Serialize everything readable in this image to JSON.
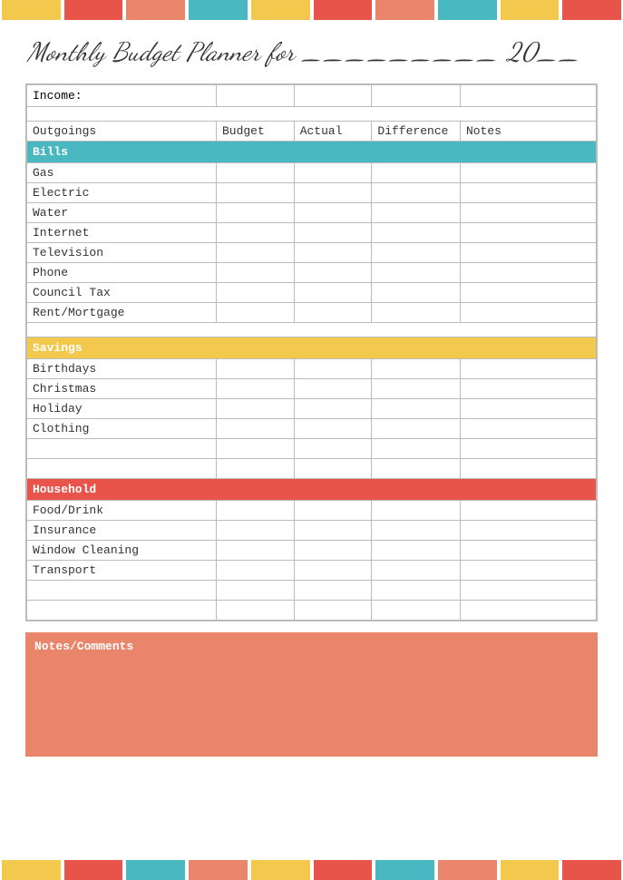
{
  "colorBarsTop": [
    {
      "color": "cb-yellow"
    },
    {
      "color": "cb-red"
    },
    {
      "color": "cb-salmon"
    },
    {
      "color": "cb-teal"
    },
    {
      "color": "cb-yellow"
    },
    {
      "color": "cb-red"
    },
    {
      "color": "cb-salmon"
    },
    {
      "color": "cb-teal"
    },
    {
      "color": "cb-yellow"
    },
    {
      "color": "cb-red"
    }
  ],
  "colorBarsBottom": [
    {
      "color": "cb-yellow"
    },
    {
      "color": "cb-red"
    },
    {
      "color": "cb-teal"
    },
    {
      "color": "cb-salmon"
    },
    {
      "color": "cb-yellow"
    },
    {
      "color": "cb-red"
    },
    {
      "color": "cb-teal"
    },
    {
      "color": "cb-salmon"
    },
    {
      "color": "cb-yellow"
    },
    {
      "color": "cb-red"
    }
  ],
  "title": "Monthly Budget Planner for _________ 20__",
  "table": {
    "incomeLabel": "Income:",
    "columns": {
      "outgoings": "Outgoings",
      "budget": "Budget",
      "actual": "Actual",
      "difference": "Difference",
      "notes": "Notes"
    },
    "categories": {
      "bills": {
        "label": "Bills",
        "items": [
          "Gas",
          "Electric",
          "Water",
          "Internet",
          "Television",
          "Phone",
          "Council Tax",
          "Rent/Mortgage"
        ]
      },
      "savings": {
        "label": "Savings",
        "items": [
          "Birthdays",
          "Christmas",
          "Holiday",
          "Clothing"
        ]
      },
      "household": {
        "label": "Household",
        "items": [
          "Food/Drink",
          "Insurance",
          "Window Cleaning",
          "Transport"
        ]
      }
    }
  },
  "notesSection": {
    "label": "Notes/Comments"
  }
}
